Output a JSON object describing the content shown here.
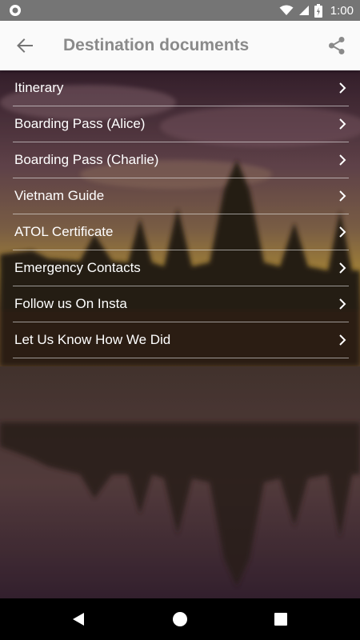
{
  "status_bar": {
    "time": "1:00",
    "icons": [
      "notification-icon",
      "wifi-icon",
      "cellular-signal-icon",
      "battery-icon"
    ]
  },
  "app_bar": {
    "title": "Destination documents",
    "back_icon": "arrow-left-icon",
    "share_icon": "share-icon"
  },
  "menu": {
    "items": [
      {
        "label": "Itinerary"
      },
      {
        "label": "Boarding Pass (Alice)"
      },
      {
        "label": "Boarding Pass (Charlie)"
      },
      {
        "label": "Vietnam Guide"
      },
      {
        "label": "ATOL Certificate"
      },
      {
        "label": "Emergency Contacts"
      },
      {
        "label": "Follow us On Insta"
      },
      {
        "label": "Let Us Know How We Did"
      }
    ],
    "chevron_icon": "chevron-right-icon"
  },
  "nav_bar": {
    "icons": [
      "back-triangle-icon",
      "home-circle-icon",
      "recents-square-icon"
    ]
  },
  "colors": {
    "status_bar": "#757575",
    "app_bar": "#fafafa",
    "title_text": "#8a8a8a",
    "menu_text": "#ffffff",
    "nav_bar": "#000000"
  }
}
